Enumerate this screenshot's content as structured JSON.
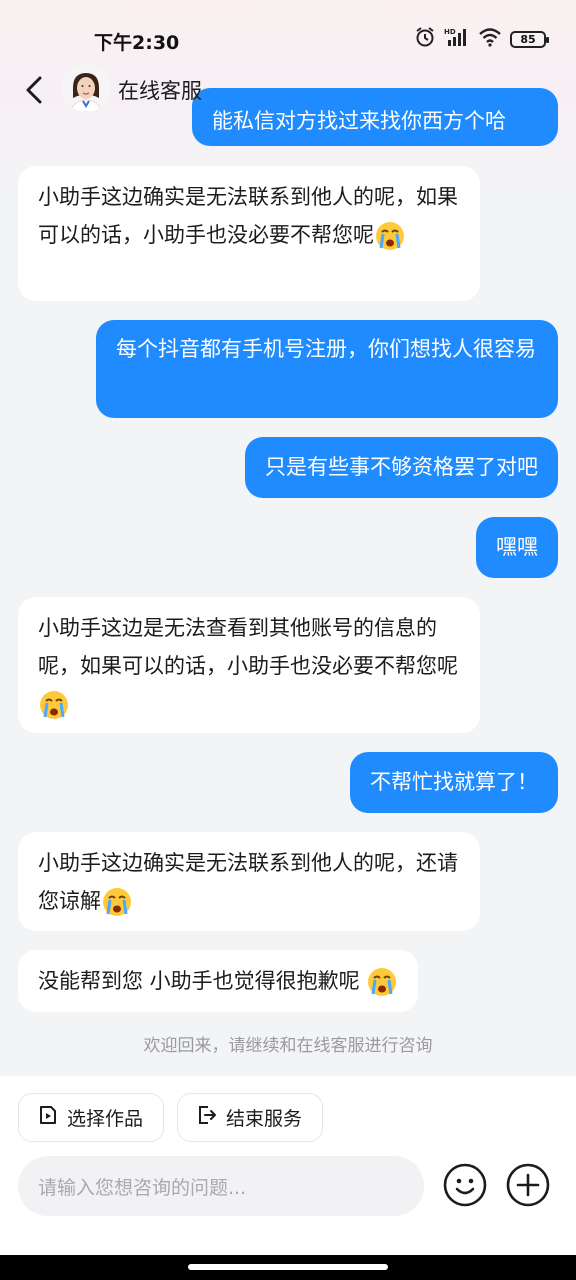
{
  "status": {
    "time": "下午2:30",
    "battery": "85"
  },
  "header": {
    "title": "在线客服"
  },
  "messages": [
    {
      "side": "right",
      "text": "能私信对方找过来找你西方个哈"
    },
    {
      "side": "left",
      "text": "小助手这边确实是无法联系到他人的呢，如果可以的话，小助手也没必要不帮您呢",
      "emoji": "crying-face"
    },
    {
      "side": "right",
      "text": "每个抖音都有手机号注册，你们想找人很容易"
    },
    {
      "side": "right",
      "text": "只是有些事不够资格罢了对吧"
    },
    {
      "side": "right",
      "text": "嘿嘿"
    },
    {
      "side": "left",
      "text": "小助手这边是无法查看到其他账号的信息的呢，如果可以的话，小助手也没必要不帮您呢",
      "emoji": "crying-face"
    },
    {
      "side": "right",
      "text": "不帮忙找就算了！"
    },
    {
      "side": "left",
      "text": "小助手这边确实是无法联系到他人的呢，还请您谅解",
      "emoji": "crying-face"
    },
    {
      "side": "left",
      "text": "没能帮到您 小助手也觉得很抱歉呢",
      "emoji": "crying-face"
    }
  ],
  "system_note": "欢迎回来，请继续和在线客服进行咨询",
  "actions": {
    "select_work": "选择作品",
    "end_service": "结束服务"
  },
  "input": {
    "placeholder": "请输入您想咨询的问题..."
  },
  "colors": {
    "accent": "#1f8bff",
    "bubble_left": "#ffffff",
    "background": "#f3f4f6"
  }
}
